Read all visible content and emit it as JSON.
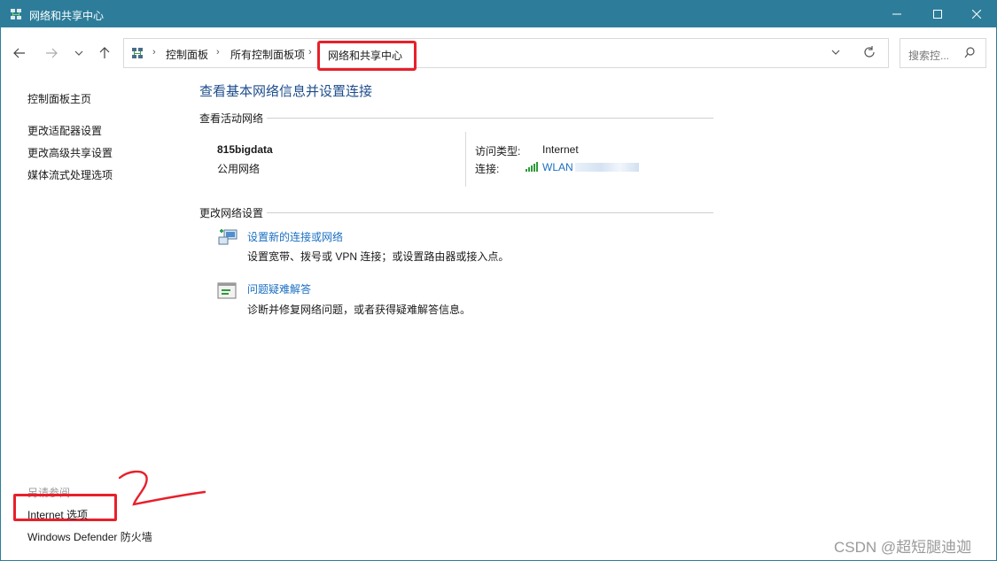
{
  "window": {
    "title": "网络和共享中心"
  },
  "nav": {
    "breadcrumbs": [
      "控制面板",
      "所有控制面板项",
      "网络和共享中心"
    ],
    "search_placeholder": "搜索控..."
  },
  "sidebar": {
    "links": [
      "控制面板主页",
      "更改适配器设置",
      "更改高级共享设置",
      "媒体流式处理选项"
    ],
    "see_also_title": "另请参阅",
    "see_also": [
      "Internet 选项",
      "Windows Defender 防火墙"
    ]
  },
  "main": {
    "title": "查看基本网络信息并设置连接",
    "active_networks_heading": "查看活动网络",
    "network": {
      "name": "815bigdata",
      "category": "公用网络",
      "access_type_label": "访问类型:",
      "access_type_value": "Internet",
      "connection_label": "连接:",
      "connection_value": "WLAN"
    },
    "change_settings_heading": "更改网络设置",
    "tasks": [
      {
        "link": "设置新的连接或网络",
        "desc": "设置宽带、拨号或 VPN 连接；或设置路由器或接入点。"
      },
      {
        "link": "问题疑难解答",
        "desc": "诊断并修复网络问题，或者获得疑难解答信息。"
      }
    ]
  },
  "annotation": {
    "mark": "2"
  },
  "watermark": "CSDN @超短腿迪迦",
  "colors": {
    "titlebar": "#2d7d9a",
    "link": "#1a6fc2",
    "heading": "#1e4e8c",
    "highlight": "#e8202a"
  }
}
